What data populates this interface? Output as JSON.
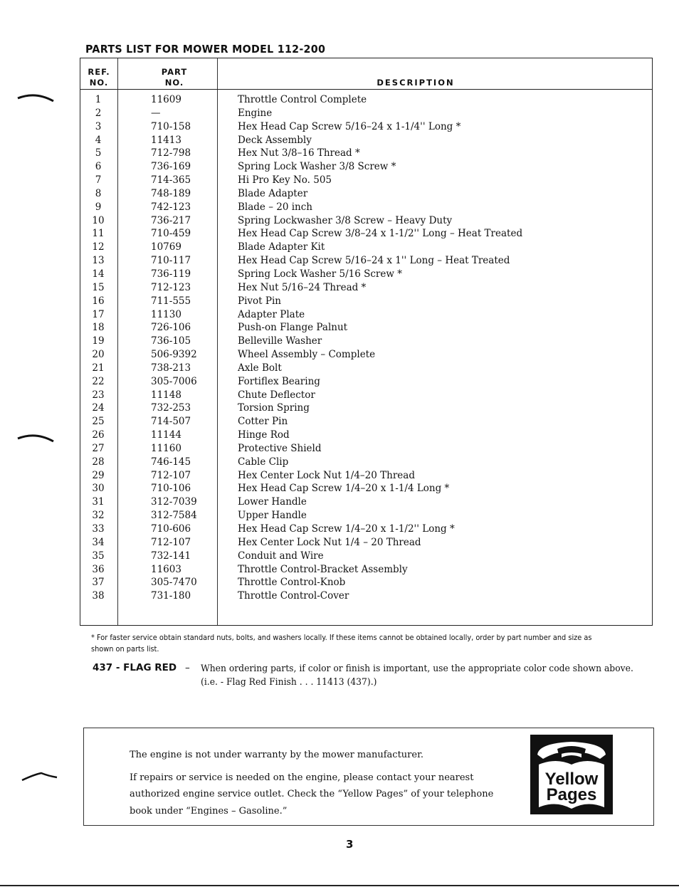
{
  "page": {
    "title": "PARTS LIST FOR MOWER MODEL 112-200",
    "page_number": "3"
  },
  "table": {
    "headers": {
      "ref_no_line1": "REF.",
      "ref_no_line2": "NO.",
      "part_no_line1": "PART",
      "part_no_line2": "NO.",
      "description": "DESCRIPTION"
    },
    "rows": [
      {
        "ref": "1",
        "part": "11609",
        "desc": "Throttle Control Complete"
      },
      {
        "ref": "2",
        "part": "—",
        "desc": "Engine"
      },
      {
        "ref": "3",
        "part": "710-158",
        "desc": "Hex Head Cap Screw 5/16–24 x 1-1/4'' Long *"
      },
      {
        "ref": "4",
        "part": "11413",
        "desc": "Deck Assembly"
      },
      {
        "ref": "5",
        "part": "712-798",
        "desc": "Hex Nut 3/8–16 Thread *"
      },
      {
        "ref": "6",
        "part": "736-169",
        "desc": "Spring Lock Washer 3/8 Screw *"
      },
      {
        "ref": "7",
        "part": "714-365",
        "desc": "Hi Pro Key No. 505"
      },
      {
        "ref": "8",
        "part": "748-189",
        "desc": "Blade Adapter"
      },
      {
        "ref": "9",
        "part": "742-123",
        "desc": "Blade – 20 inch"
      },
      {
        "ref": "10",
        "part": "736-217",
        "desc": "Spring Lockwasher 3/8 Screw – Heavy Duty"
      },
      {
        "ref": "11",
        "part": "710-459",
        "desc": "Hex Head Cap Screw 3/8–24 x 1-1/2'' Long – Heat Treated"
      },
      {
        "ref": "12",
        "part": "10769",
        "desc": "Blade Adapter Kit"
      },
      {
        "ref": "13",
        "part": "710-117",
        "desc": "Hex Head Cap Screw 5/16–24 x 1'' Long – Heat Treated"
      },
      {
        "ref": "14",
        "part": "736-119",
        "desc": "Spring Lock Washer 5/16 Screw *"
      },
      {
        "ref": "15",
        "part": "712-123",
        "desc": "Hex Nut 5/16–24 Thread *"
      },
      {
        "ref": "16",
        "part": "711-555",
        "desc": "Pivot Pin"
      },
      {
        "ref": "17",
        "part": "11130",
        "desc": "Adapter Plate"
      },
      {
        "ref": "18",
        "part": "726-106",
        "desc": "Push-on Flange Palnut"
      },
      {
        "ref": "19",
        "part": "736-105",
        "desc": "Belleville Washer"
      },
      {
        "ref": "20",
        "part": "506-9392",
        "desc": "Wheel Assembly – Complete"
      },
      {
        "ref": "21",
        "part": "738-213",
        "desc": "Axle Bolt"
      },
      {
        "ref": "22",
        "part": "305-7006",
        "desc": "Fortiflex Bearing"
      },
      {
        "ref": "23",
        "part": "11148",
        "desc": "Chute Deflector"
      },
      {
        "ref": "24",
        "part": "732-253",
        "desc": "Torsion Spring"
      },
      {
        "ref": "25",
        "part": "714-507",
        "desc": "Cotter Pin"
      },
      {
        "ref": "26",
        "part": "11144",
        "desc": "Hinge Rod"
      },
      {
        "ref": "27",
        "part": "11160",
        "desc": "Protective Shield"
      },
      {
        "ref": "28",
        "part": "746-145",
        "desc": "Cable Clip"
      },
      {
        "ref": "29",
        "part": "712-107",
        "desc": "Hex Center Lock Nut 1/4–20 Thread"
      },
      {
        "ref": "30",
        "part": "710-106",
        "desc": "Hex Head Cap Screw 1/4–20 x 1-1/4 Long *"
      },
      {
        "ref": "31",
        "part": "312-7039",
        "desc": "Lower Handle"
      },
      {
        "ref": "32",
        "part": "312-7584",
        "desc": "Upper Handle"
      },
      {
        "ref": "33",
        "part": "710-606",
        "desc": "Hex Head Cap Screw 1/4–20 x 1-1/2'' Long *"
      },
      {
        "ref": "34",
        "part": "712-107",
        "desc": "Hex Center Lock Nut 1/4 – 20 Thread"
      },
      {
        "ref": "35",
        "part": "732-141",
        "desc": "Conduit and Wire"
      },
      {
        "ref": "36",
        "part": "11603",
        "desc": "Throttle Control-Bracket Assembly"
      },
      {
        "ref": "37",
        "part": "305-7470",
        "desc": "Throttle Control-Knob"
      },
      {
        "ref": "38",
        "part": "731-180",
        "desc": "Throttle Control-Cover"
      }
    ]
  },
  "footnote": "* For faster service obtain standard nuts, bolts, and washers locally. If these items cannot be obtained locally, order by part number and size as shown on parts list.",
  "color_code": {
    "label": "437 - FLAG RED",
    "dash": "–",
    "text": "When ordering parts, if color or finish is important, use the appropriate color code shown above. (i.e. - Flag Red Finish . . . 11413 (437).)"
  },
  "warranty": {
    "line1": "The engine is not under warranty by the mower manufacturer.",
    "line2": "If repairs or service is needed on the engine, please contact your nearest authorized engine service outlet. Check the “Yellow Pages” of your telephone book under “Engines – Gasoline.”",
    "logo_line1": "Yellow",
    "logo_line2": "Pages"
  }
}
